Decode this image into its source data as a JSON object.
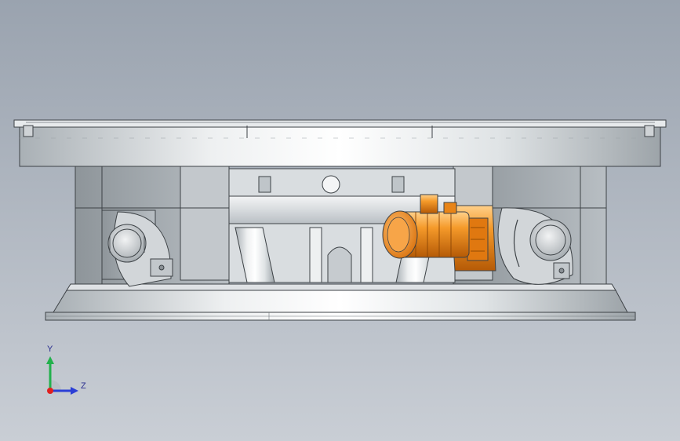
{
  "viewport": {
    "background_top": "#9aa3af",
    "background_bottom": "#c9ced5"
  },
  "model": {
    "parts": [
      "top-frame-plate",
      "left-wheel-assembly",
      "right-wheel-assembly",
      "center-column-structure",
      "drive-motor",
      "gear-reducer",
      "base-rail-ring"
    ],
    "colors": {
      "steel_light": "#e9ecef",
      "steel_mid": "#c8cdd2",
      "steel_dark": "#8f969c",
      "edge": "#3d4246",
      "motor_orange": "#f08a1c",
      "motor_dark": "#b85d08"
    }
  },
  "triad": {
    "y_label": "Y",
    "z_label": "Z",
    "y_color": "#22b14c",
    "z_color": "#2b3fd6",
    "x_color": "#e02020",
    "label_color": "#2a2d8f"
  }
}
